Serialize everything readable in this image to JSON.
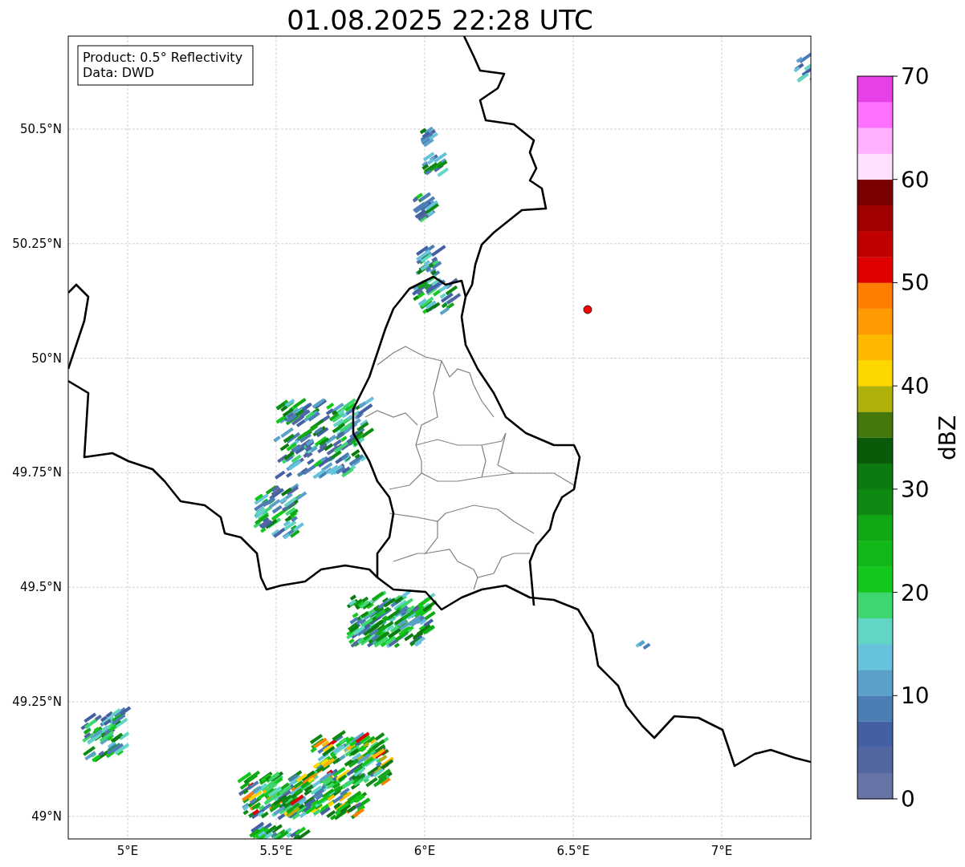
{
  "title": "01.08.2025 22:28 UTC",
  "legend": [
    "Product: 0.5° Reflectivity",
    "Data: DWD"
  ],
  "xticks": [
    "5°E",
    "5.5°E",
    "6°E",
    "6.5°E",
    "7°E"
  ],
  "yticks": [
    "50.5°N",
    "50.25°N",
    "50°N",
    "49.75°N",
    "49.5°N",
    "49.25°N",
    "49°N"
  ],
  "colorbar": {
    "label": "dBZ",
    "ticks": [
      "70",
      "60",
      "50",
      "40",
      "30",
      "20",
      "10",
      "0"
    ],
    "bins": [
      {
        "color": "#6674a6"
      },
      {
        "color": "#5266a0"
      },
      {
        "color": "#4460a4"
      },
      {
        "color": "#4c7db5"
      },
      {
        "color": "#5aa0c8"
      },
      {
        "color": "#66c3db"
      },
      {
        "color": "#62d6c4"
      },
      {
        "color": "#3ed66e"
      },
      {
        "color": "#12c81a"
      },
      {
        "color": "#10b818"
      },
      {
        "color": "#10a814"
      },
      {
        "color": "#0e8a12"
      },
      {
        "color": "#0c7a10"
      },
      {
        "color": "#0a5a0a"
      },
      {
        "color": "#44780c"
      },
      {
        "color": "#b0b00a"
      },
      {
        "color": "#ffd700"
      },
      {
        "color": "#ffb800"
      },
      {
        "color": "#ff9a00"
      },
      {
        "color": "#ff7d00"
      },
      {
        "color": "#e00000"
      },
      {
        "color": "#c00000"
      },
      {
        "color": "#a00000"
      },
      {
        "color": "#7a0000"
      },
      {
        "color": "#ffe0ff"
      },
      {
        "color": "#ffb0ff"
      },
      {
        "color": "#ff70ff"
      },
      {
        "color": "#e840e8"
      }
    ]
  }
}
